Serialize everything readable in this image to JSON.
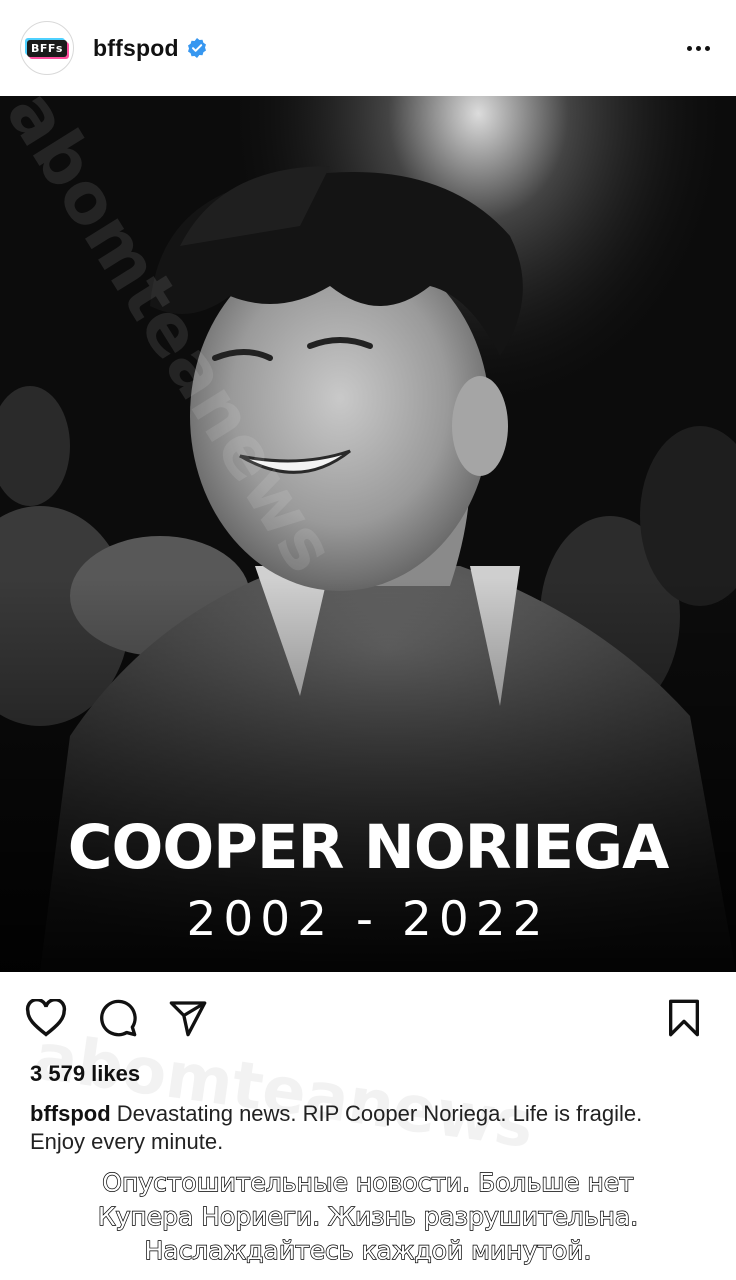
{
  "header": {
    "avatar_text": "BFFs",
    "username": "bffspod",
    "verified": true
  },
  "post": {
    "overlay_name": "COOPER NORIEGA",
    "overlay_years": "2002 - 2022",
    "likes": "3 579 likes",
    "caption_user": "bffspod",
    "caption_text": "Devastating news. RIP Cooper Noriega. Life is fragile. Enjoy every minute."
  },
  "subtitle": "Опустошительные новости. Больше нет Купера Нориеги. Жизнь разрушительна. Наслаждайтесь каждой минутой.",
  "watermark": "abomteanews",
  "icons": {
    "like": "heart-icon",
    "comment": "comment-icon",
    "share": "send-icon",
    "save": "bookmark-icon",
    "more": "more-horizontal-icon",
    "verified": "verified-badge-icon"
  },
  "colors": {
    "verified": "#3797f0",
    "text": "#111111",
    "photo_bg": "#0a0a0a"
  }
}
